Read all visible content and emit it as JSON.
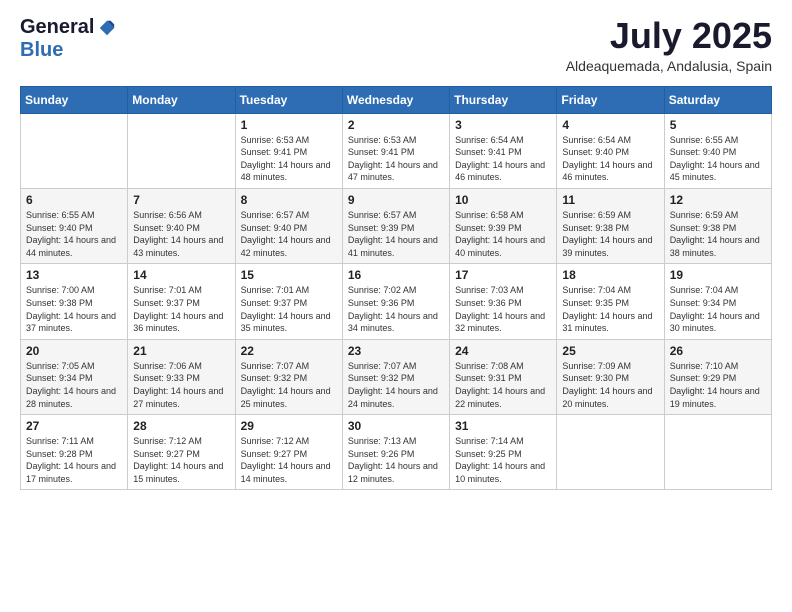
{
  "logo": {
    "general": "General",
    "blue": "Blue"
  },
  "title": {
    "month_year": "July 2025",
    "location": "Aldeaquemada, Andalusia, Spain"
  },
  "weekdays": [
    "Sunday",
    "Monday",
    "Tuesday",
    "Wednesday",
    "Thursday",
    "Friday",
    "Saturday"
  ],
  "weeks": [
    [
      {
        "day": "",
        "sunrise": "",
        "sunset": "",
        "daylight": ""
      },
      {
        "day": "",
        "sunrise": "",
        "sunset": "",
        "daylight": ""
      },
      {
        "day": "1",
        "sunrise": "Sunrise: 6:53 AM",
        "sunset": "Sunset: 9:41 PM",
        "daylight": "Daylight: 14 hours and 48 minutes."
      },
      {
        "day": "2",
        "sunrise": "Sunrise: 6:53 AM",
        "sunset": "Sunset: 9:41 PM",
        "daylight": "Daylight: 14 hours and 47 minutes."
      },
      {
        "day": "3",
        "sunrise": "Sunrise: 6:54 AM",
        "sunset": "Sunset: 9:41 PM",
        "daylight": "Daylight: 14 hours and 46 minutes."
      },
      {
        "day": "4",
        "sunrise": "Sunrise: 6:54 AM",
        "sunset": "Sunset: 9:40 PM",
        "daylight": "Daylight: 14 hours and 46 minutes."
      },
      {
        "day": "5",
        "sunrise": "Sunrise: 6:55 AM",
        "sunset": "Sunset: 9:40 PM",
        "daylight": "Daylight: 14 hours and 45 minutes."
      }
    ],
    [
      {
        "day": "6",
        "sunrise": "Sunrise: 6:55 AM",
        "sunset": "Sunset: 9:40 PM",
        "daylight": "Daylight: 14 hours and 44 minutes."
      },
      {
        "day": "7",
        "sunrise": "Sunrise: 6:56 AM",
        "sunset": "Sunset: 9:40 PM",
        "daylight": "Daylight: 14 hours and 43 minutes."
      },
      {
        "day": "8",
        "sunrise": "Sunrise: 6:57 AM",
        "sunset": "Sunset: 9:40 PM",
        "daylight": "Daylight: 14 hours and 42 minutes."
      },
      {
        "day": "9",
        "sunrise": "Sunrise: 6:57 AM",
        "sunset": "Sunset: 9:39 PM",
        "daylight": "Daylight: 14 hours and 41 minutes."
      },
      {
        "day": "10",
        "sunrise": "Sunrise: 6:58 AM",
        "sunset": "Sunset: 9:39 PM",
        "daylight": "Daylight: 14 hours and 40 minutes."
      },
      {
        "day": "11",
        "sunrise": "Sunrise: 6:59 AM",
        "sunset": "Sunset: 9:38 PM",
        "daylight": "Daylight: 14 hours and 39 minutes."
      },
      {
        "day": "12",
        "sunrise": "Sunrise: 6:59 AM",
        "sunset": "Sunset: 9:38 PM",
        "daylight": "Daylight: 14 hours and 38 minutes."
      }
    ],
    [
      {
        "day": "13",
        "sunrise": "Sunrise: 7:00 AM",
        "sunset": "Sunset: 9:38 PM",
        "daylight": "Daylight: 14 hours and 37 minutes."
      },
      {
        "day": "14",
        "sunrise": "Sunrise: 7:01 AM",
        "sunset": "Sunset: 9:37 PM",
        "daylight": "Daylight: 14 hours and 36 minutes."
      },
      {
        "day": "15",
        "sunrise": "Sunrise: 7:01 AM",
        "sunset": "Sunset: 9:37 PM",
        "daylight": "Daylight: 14 hours and 35 minutes."
      },
      {
        "day": "16",
        "sunrise": "Sunrise: 7:02 AM",
        "sunset": "Sunset: 9:36 PM",
        "daylight": "Daylight: 14 hours and 34 minutes."
      },
      {
        "day": "17",
        "sunrise": "Sunrise: 7:03 AM",
        "sunset": "Sunset: 9:36 PM",
        "daylight": "Daylight: 14 hours and 32 minutes."
      },
      {
        "day": "18",
        "sunrise": "Sunrise: 7:04 AM",
        "sunset": "Sunset: 9:35 PM",
        "daylight": "Daylight: 14 hours and 31 minutes."
      },
      {
        "day": "19",
        "sunrise": "Sunrise: 7:04 AM",
        "sunset": "Sunset: 9:34 PM",
        "daylight": "Daylight: 14 hours and 30 minutes."
      }
    ],
    [
      {
        "day": "20",
        "sunrise": "Sunrise: 7:05 AM",
        "sunset": "Sunset: 9:34 PM",
        "daylight": "Daylight: 14 hours and 28 minutes."
      },
      {
        "day": "21",
        "sunrise": "Sunrise: 7:06 AM",
        "sunset": "Sunset: 9:33 PM",
        "daylight": "Daylight: 14 hours and 27 minutes."
      },
      {
        "day": "22",
        "sunrise": "Sunrise: 7:07 AM",
        "sunset": "Sunset: 9:32 PM",
        "daylight": "Daylight: 14 hours and 25 minutes."
      },
      {
        "day": "23",
        "sunrise": "Sunrise: 7:07 AM",
        "sunset": "Sunset: 9:32 PM",
        "daylight": "Daylight: 14 hours and 24 minutes."
      },
      {
        "day": "24",
        "sunrise": "Sunrise: 7:08 AM",
        "sunset": "Sunset: 9:31 PM",
        "daylight": "Daylight: 14 hours and 22 minutes."
      },
      {
        "day": "25",
        "sunrise": "Sunrise: 7:09 AM",
        "sunset": "Sunset: 9:30 PM",
        "daylight": "Daylight: 14 hours and 20 minutes."
      },
      {
        "day": "26",
        "sunrise": "Sunrise: 7:10 AM",
        "sunset": "Sunset: 9:29 PM",
        "daylight": "Daylight: 14 hours and 19 minutes."
      }
    ],
    [
      {
        "day": "27",
        "sunrise": "Sunrise: 7:11 AM",
        "sunset": "Sunset: 9:28 PM",
        "daylight": "Daylight: 14 hours and 17 minutes."
      },
      {
        "day": "28",
        "sunrise": "Sunrise: 7:12 AM",
        "sunset": "Sunset: 9:27 PM",
        "daylight": "Daylight: 14 hours and 15 minutes."
      },
      {
        "day": "29",
        "sunrise": "Sunrise: 7:12 AM",
        "sunset": "Sunset: 9:27 PM",
        "daylight": "Daylight: 14 hours and 14 minutes."
      },
      {
        "day": "30",
        "sunrise": "Sunrise: 7:13 AM",
        "sunset": "Sunset: 9:26 PM",
        "daylight": "Daylight: 14 hours and 12 minutes."
      },
      {
        "day": "31",
        "sunrise": "Sunrise: 7:14 AM",
        "sunset": "Sunset: 9:25 PM",
        "daylight": "Daylight: 14 hours and 10 minutes."
      },
      {
        "day": "",
        "sunrise": "",
        "sunset": "",
        "daylight": ""
      },
      {
        "day": "",
        "sunrise": "",
        "sunset": "",
        "daylight": ""
      }
    ]
  ]
}
